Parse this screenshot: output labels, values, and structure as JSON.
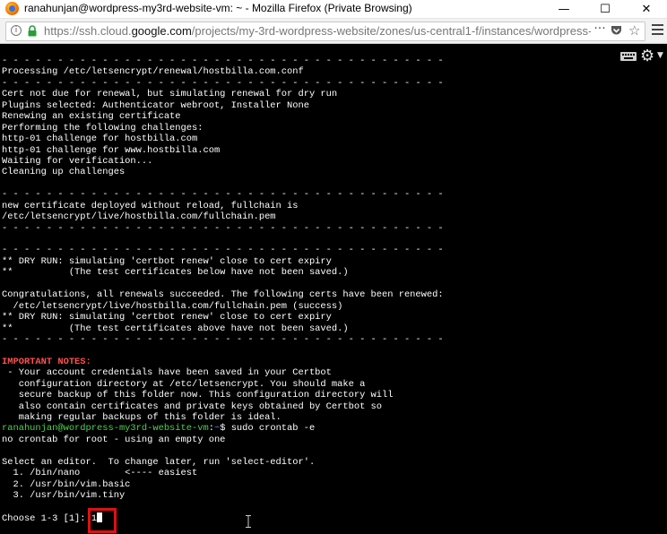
{
  "window": {
    "title": "ranahunjan@wordpress-my3rd-website-vm: ~ - Mozilla Firefox (Private Browsing)",
    "minimize_glyph": "—",
    "maximize_glyph": "☐",
    "close_glyph": "✕"
  },
  "address_bar": {
    "url_prefix": "https://ssh.cloud.",
    "url_domain": "google.com",
    "url_path": "/projects/my-3rd-wordpress-website/zones/us-central1-f/instances/wordpress-my3rd-w",
    "more_glyph": "···"
  },
  "terminal": {
    "lines": [
      {
        "segments": [
          {
            "t": "- - - - - - - - - - - - - - - - - - - - - - - - - - - - - - - - - - - - - - - -"
          }
        ]
      },
      {
        "segments": [
          {
            "t": "Processing /etc/letsencrypt/renewal/hostbilla.com.conf"
          }
        ]
      },
      {
        "segments": [
          {
            "t": "- - - - - - - - - - - - - - - - - - - - - - - - - - - - - - - - - - - - - - - -"
          }
        ]
      },
      {
        "segments": [
          {
            "t": "Cert not due for renewal, but simulating renewal for dry run"
          }
        ]
      },
      {
        "segments": [
          {
            "t": "Plugins selected: Authenticator webroot, Installer None"
          }
        ]
      },
      {
        "segments": [
          {
            "t": "Renewing an existing certificate"
          }
        ]
      },
      {
        "segments": [
          {
            "t": "Performing the following challenges:"
          }
        ]
      },
      {
        "segments": [
          {
            "t": "http-01 challenge for hostbilla.com"
          }
        ]
      },
      {
        "segments": [
          {
            "t": "http-01 challenge for www.hostbilla.com"
          }
        ]
      },
      {
        "segments": [
          {
            "t": "Waiting for verification..."
          }
        ]
      },
      {
        "segments": [
          {
            "t": "Cleaning up challenges"
          }
        ]
      },
      {
        "segments": [
          {
            "t": ""
          }
        ]
      },
      {
        "segments": [
          {
            "t": "- - - - - - - - - - - - - - - - - - - - - - - - - - - - - - - - - - - - - - - -"
          }
        ]
      },
      {
        "segments": [
          {
            "t": "new certificate deployed without reload, fullchain is"
          }
        ]
      },
      {
        "segments": [
          {
            "t": "/etc/letsencrypt/live/hostbilla.com/fullchain.pem"
          }
        ]
      },
      {
        "segments": [
          {
            "t": "- - - - - - - - - - - - - - - - - - - - - - - - - - - - - - - - - - - - - - - -"
          }
        ]
      },
      {
        "segments": [
          {
            "t": ""
          }
        ]
      },
      {
        "segments": [
          {
            "t": "- - - - - - - - - - - - - - - - - - - - - - - - - - - - - - - - - - - - - - - -"
          }
        ]
      },
      {
        "segments": [
          {
            "t": "** DRY RUN: simulating 'certbot renew' close to cert expiry"
          }
        ]
      },
      {
        "segments": [
          {
            "t": "**          (The test certificates below have not been saved.)"
          }
        ]
      },
      {
        "segments": [
          {
            "t": ""
          }
        ]
      },
      {
        "segments": [
          {
            "t": "Congratulations, all renewals succeeded. The following certs have been renewed:"
          }
        ]
      },
      {
        "segments": [
          {
            "t": "  /etc/letsencrypt/live/hostbilla.com/fullchain.pem (success)"
          }
        ]
      },
      {
        "segments": [
          {
            "t": "** DRY RUN: simulating 'certbot renew' close to cert expiry"
          }
        ]
      },
      {
        "segments": [
          {
            "t": "**          (The test certificates above have not been saved.)"
          }
        ]
      },
      {
        "segments": [
          {
            "t": "- - - - - - - - - - - - - - - - - - - - - - - - - - - - - - - - - - - - - - - -"
          }
        ]
      },
      {
        "segments": [
          {
            "t": ""
          }
        ]
      },
      {
        "segments": [
          {
            "t": "IMPORTANT NOTES:",
            "c": "c-red c-bold"
          }
        ]
      },
      {
        "segments": [
          {
            "t": " - Your account credentials have been saved in your Certbot"
          }
        ]
      },
      {
        "segments": [
          {
            "t": "   configuration directory at /etc/letsencrypt. You should make a"
          }
        ]
      },
      {
        "segments": [
          {
            "t": "   secure backup of this folder now. This configuration directory will"
          }
        ]
      },
      {
        "segments": [
          {
            "t": "   also contain certificates and private keys obtained by Certbot so"
          }
        ]
      },
      {
        "segments": [
          {
            "t": "   making regular backups of this folder is ideal."
          }
        ]
      },
      {
        "segments": [
          {
            "t": "ranahunjan@wordpress-my3rd-website-vm",
            "c": "c-green"
          },
          {
            "t": ":"
          },
          {
            "t": "~",
            "c": "c-blue"
          },
          {
            "t": "$ sudo crontab -e"
          }
        ]
      },
      {
        "segments": [
          {
            "t": "no crontab for root - using an empty one"
          }
        ]
      },
      {
        "segments": [
          {
            "t": ""
          }
        ]
      },
      {
        "segments": [
          {
            "t": "Select an editor.  To change later, run 'select-editor'."
          }
        ]
      },
      {
        "segments": [
          {
            "t": "  1. /bin/nano        <---- easiest"
          }
        ]
      },
      {
        "segments": [
          {
            "t": "  2. /usr/bin/vim.basic"
          }
        ]
      },
      {
        "segments": [
          {
            "t": "  3. /usr/bin/vim.tiny"
          }
        ]
      },
      {
        "segments": [
          {
            "t": ""
          }
        ]
      },
      {
        "segments": [
          {
            "t": "Choose 1-3 [1]: 1"
          }
        ],
        "cursor": true
      }
    ]
  }
}
